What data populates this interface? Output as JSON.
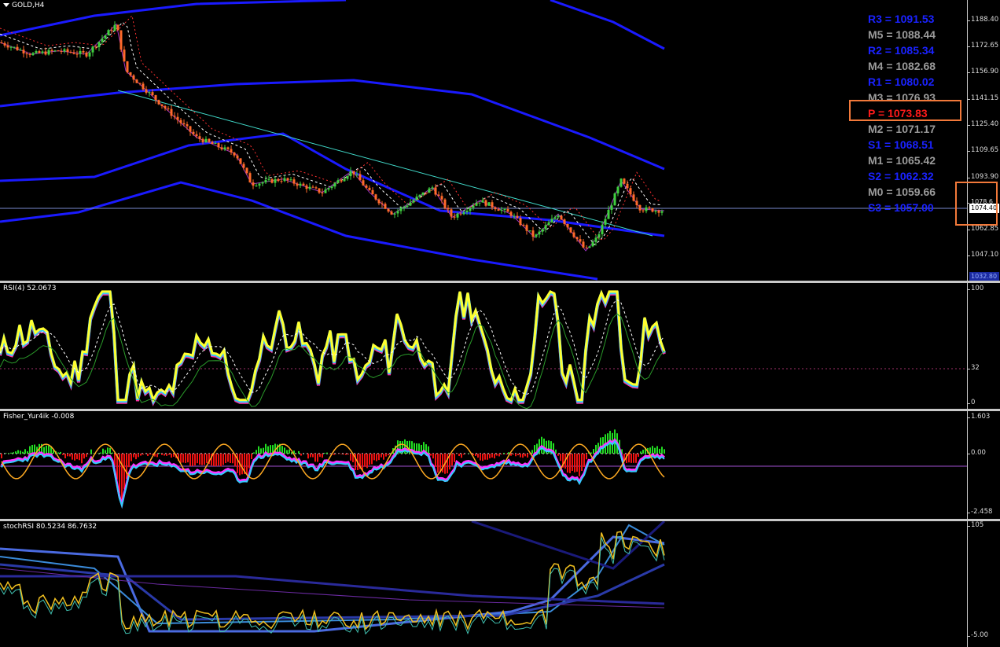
{
  "main": {
    "title": "GOLD,H4",
    "current_price": "1074.40",
    "upper_price": "1078.6",
    "bottom_badge": "1032.80",
    "price_ticks": [
      "1188.40",
      "1172.65",
      "1156.90",
      "1141.15",
      "1125.40",
      "1109.65",
      "1093.90",
      "1078.60",
      "1062.85",
      "1047.10"
    ],
    "pivots": [
      {
        "text": "R3 = 1091.53",
        "color": "#1a22ff",
        "highlight": false
      },
      {
        "text": "M5 = 1088.44",
        "color": "#9a9a9a",
        "highlight": false
      },
      {
        "text": "R2 = 1085.34",
        "color": "#1a22ff",
        "highlight": false
      },
      {
        "text": "M4 = 1082.68",
        "color": "#9a9a9a",
        "highlight": false
      },
      {
        "text": "R1 = 1080.02",
        "color": "#1a22ff",
        "highlight": false
      },
      {
        "text": "M3 = 1076.93",
        "color": "#9a9a9a",
        "highlight": false
      },
      {
        "text": "P  = 1073.83",
        "color": "#ff1a1a",
        "highlight": true
      },
      {
        "text": "M2 = 1071.17",
        "color": "#9a9a9a",
        "highlight": false
      },
      {
        "text": "S1 = 1068.51",
        "color": "#1a22ff",
        "highlight": false
      },
      {
        "text": "M1 = 1065.42",
        "color": "#9a9a9a",
        "highlight": false
      },
      {
        "text": "S2 = 1062.32",
        "color": "#1a22ff",
        "highlight": false
      },
      {
        "text": "M0 = 1059.66",
        "color": "#9a9a9a",
        "highlight": false
      },
      {
        "text": "S3 = 1057.00",
        "color": "#1a22ff",
        "highlight": false
      }
    ],
    "colors": {
      "bull": "#3fcf3f",
      "bear": "#ff6a2a",
      "envelope": "#1a1aff",
      "trendline": "#40d8c8",
      "ma": "#ff3030"
    }
  },
  "rsi": {
    "title": "RSI(4) 52.0673",
    "ticks": [
      "100",
      "32",
      "0"
    ],
    "level": 32
  },
  "fisher": {
    "title": "Fisher_Yur4ik -0.008",
    "ticks": [
      "1.603",
      "0.00",
      "-2.458"
    ],
    "colors": {
      "positive": "#22dd22",
      "negative": "#ee1111",
      "line1": "#ff33ff",
      "line2": "#33ccff",
      "signal": "#ffaa22"
    }
  },
  "stoch": {
    "title": "stochRSI 80.5234 86.7632",
    "ticks": [
      "105",
      "-5.00"
    ]
  }
}
